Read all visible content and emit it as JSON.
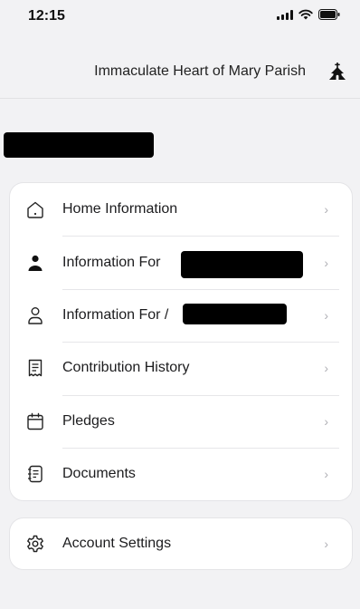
{
  "status_bar": {
    "time": "12:15"
  },
  "header": {
    "title": "Immaculate Heart of Mary Parish",
    "icon": "church-icon"
  },
  "menu_items": [
    {
      "label": "Home Information",
      "icon": "house-icon"
    },
    {
      "label": "Information For",
      "icon": "person-filled-icon"
    },
    {
      "label": "Information For /",
      "icon": "person-outline-icon"
    },
    {
      "label": "Contribution History",
      "icon": "receipt-icon"
    },
    {
      "label": "Pledges",
      "icon": "calendar-icon"
    },
    {
      "label": "Documents",
      "icon": "document-icon"
    }
  ],
  "settings": {
    "label": "Account Settings",
    "icon": "gear-icon"
  },
  "chevron_glyph": "›",
  "colors": {
    "background": "#f2f2f4",
    "card": "#ffffff",
    "text": "#1c1c1e",
    "chevron": "#b0b0b5"
  }
}
